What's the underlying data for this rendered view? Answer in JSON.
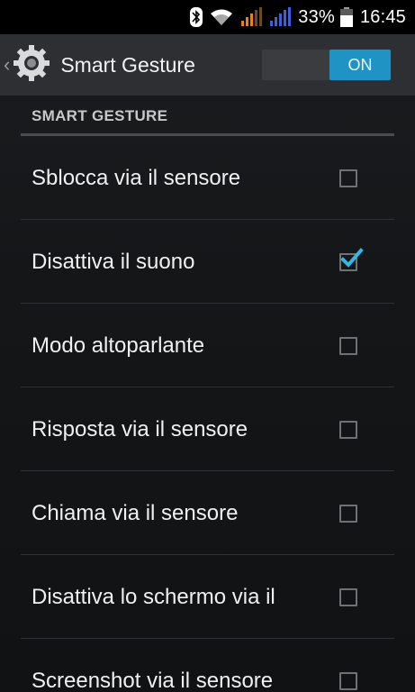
{
  "status_bar": {
    "battery_percent": "33%",
    "time": "16:45",
    "icons": [
      "bluetooth-icon",
      "wifi-icon",
      "signal-orange-icon",
      "signal-blue-icon",
      "battery-icon"
    ]
  },
  "action_bar": {
    "back_glyph": "‹",
    "title": "Smart Gesture",
    "toggle_label": "ON",
    "toggle_state": "on",
    "icon": "gear-icon"
  },
  "section": {
    "header": "SMART GESTURE"
  },
  "items": [
    {
      "label": "Sblocca via il sensore",
      "checked": false
    },
    {
      "label": "Disattiva il suono",
      "checked": true
    },
    {
      "label": "Modo altoparlante",
      "checked": false
    },
    {
      "label": "Risposta via il sensore",
      "checked": false
    },
    {
      "label": "Chiama via il sensore",
      "checked": false
    },
    {
      "label": "Disattiva lo schermo via il",
      "checked": false
    },
    {
      "label": "Screenshot via il sensore",
      "checked": false
    }
  ],
  "colors": {
    "accent": "#1f94c4",
    "check": "#33b5e5",
    "signal_orange": "#e8801e",
    "signal_blue": "#3f5fd6"
  }
}
